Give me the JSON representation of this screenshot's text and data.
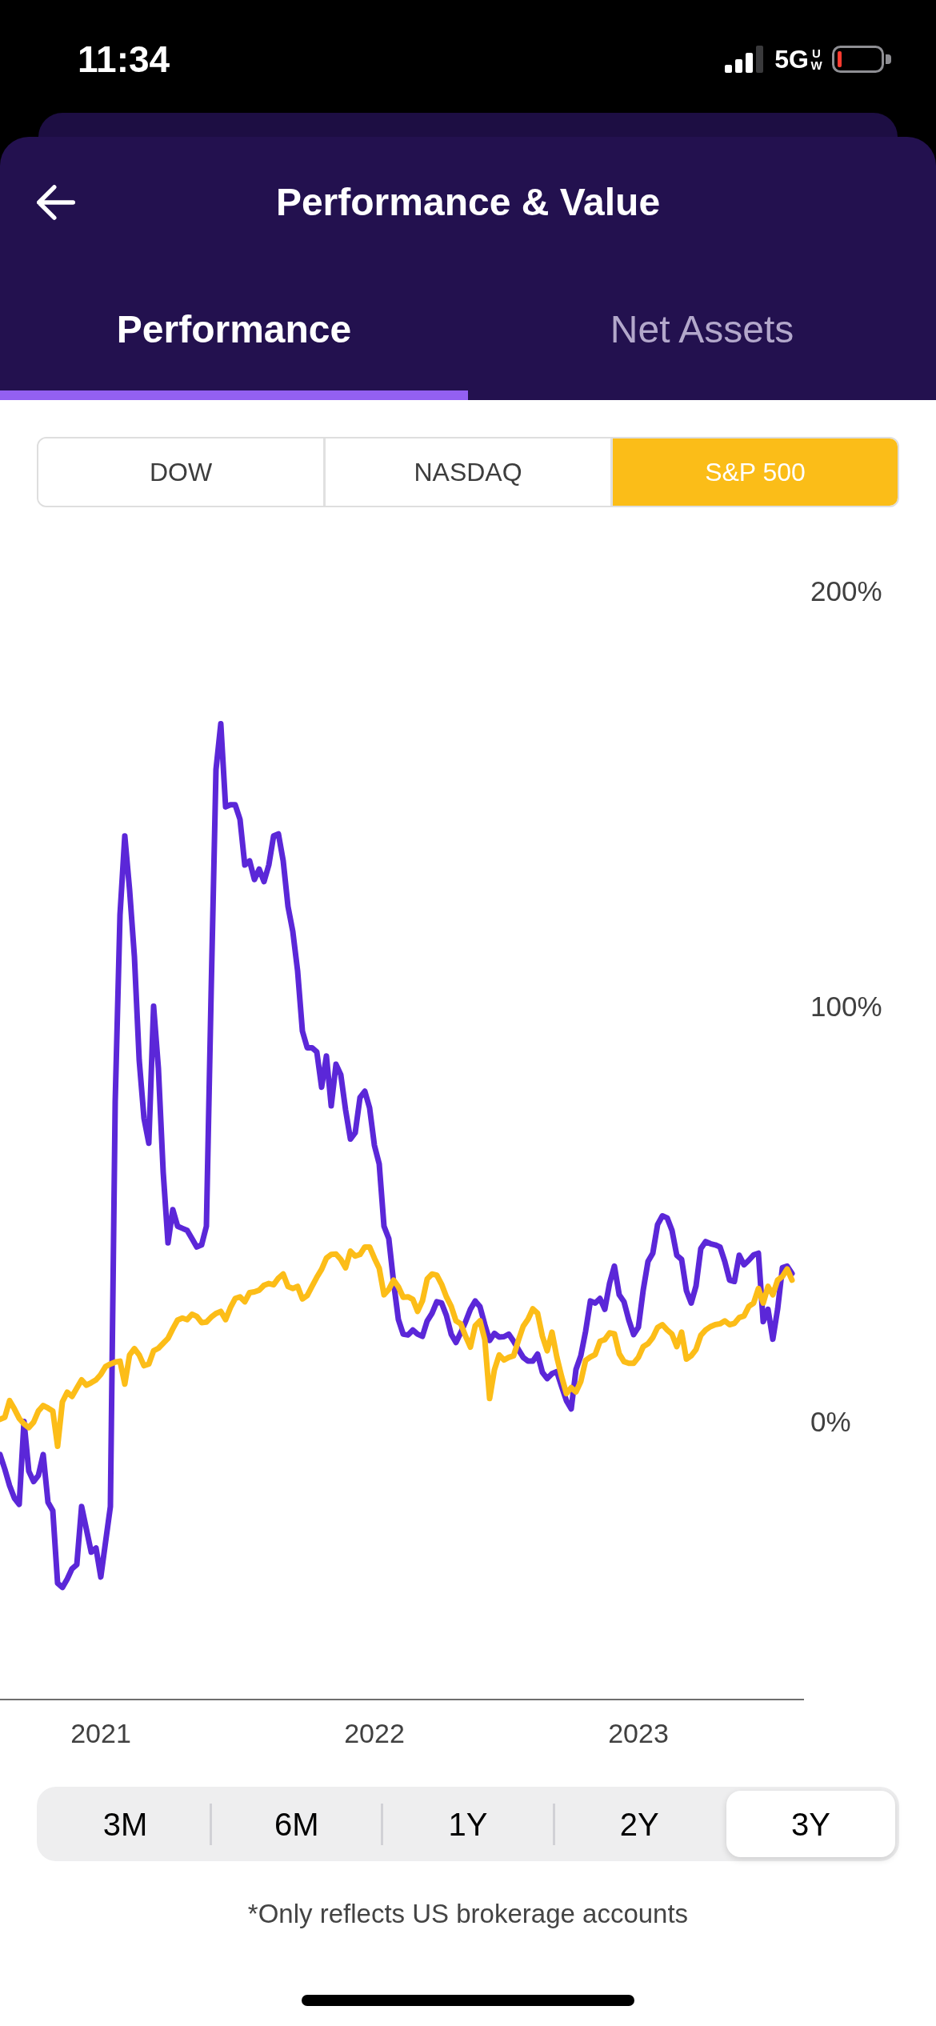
{
  "status_bar": {
    "time": "11:34",
    "network": "5G",
    "network_suffix": "UW"
  },
  "header": {
    "title": "Performance & Value"
  },
  "tabs": [
    {
      "label": "Performance",
      "selected": true
    },
    {
      "label": "Net Assets",
      "selected": false
    }
  ],
  "index_options": [
    {
      "label": "DOW",
      "selected": false
    },
    {
      "label": "NASDAQ",
      "selected": false
    },
    {
      "label": "S&P 500",
      "selected": true
    }
  ],
  "chart": {
    "chart_data": {
      "type": "line",
      "categories": [
        null,
        null,
        null,
        null,
        null,
        null,
        null,
        null,
        null,
        null,
        null,
        null,
        null,
        null,
        null,
        null,
        null,
        null,
        null,
        null,
        null,
        "2021",
        null,
        null,
        null,
        null,
        null,
        null,
        null,
        null,
        null,
        null,
        null,
        null,
        null,
        null,
        null,
        null,
        null,
        null,
        null,
        null,
        null,
        null,
        null,
        null,
        null,
        null,
        null,
        null,
        null,
        null,
        null,
        null,
        null,
        null,
        null,
        null,
        null,
        null,
        null,
        null,
        null,
        null,
        null,
        null,
        null,
        null,
        null,
        null,
        null,
        null,
        null,
        null,
        null,
        null,
        null,
        null,
        "2022",
        null,
        null,
        null,
        null,
        null,
        null,
        null,
        null,
        null,
        null,
        null,
        null,
        null,
        null,
        null,
        null,
        null,
        null,
        null,
        null,
        null,
        null,
        null,
        null,
        null,
        null,
        null,
        null,
        null,
        null,
        null,
        null,
        null,
        null,
        null,
        null,
        null,
        null,
        null,
        null,
        null,
        null,
        null,
        null,
        null,
        null,
        null,
        null,
        null,
        null,
        null,
        null,
        null,
        null,
        "2023",
        null,
        null,
        null,
        null,
        null,
        null,
        null,
        null,
        null,
        null,
        null,
        null,
        null,
        null,
        null,
        null,
        null,
        null,
        null,
        null,
        null,
        null,
        null,
        null,
        null,
        null,
        null,
        null,
        null,
        null,
        null,
        null
      ],
      "ylim": [
        -67,
        200
      ],
      "yticks": [
        {
          "value": 0,
          "label": "0%"
        },
        {
          "value": 100,
          "label": "100%"
        },
        {
          "value": 200,
          "label": "200%"
        }
      ],
      "series": [
        {
          "color": "#5b27d8",
          "values": [
            -8,
            -11.5,
            -15.5,
            -18.5,
            -20,
            0,
            -12,
            -14.5,
            -13,
            -8,
            -19.5,
            -21.5,
            -39,
            -40,
            -38,
            -35.5,
            -34.5,
            -20.5,
            -26,
            -31.5,
            -30.5,
            -37.5,
            -29,
            -20.5,
            77,
            122,
            141,
            128,
            112,
            87,
            73,
            67,
            100,
            85,
            60,
            43,
            51,
            47,
            46.5,
            46,
            44,
            42,
            42.5,
            47,
            104,
            157,
            168,
            148,
            148.5,
            148.5,
            145,
            134,
            135,
            130.5,
            133,
            130,
            134,
            141,
            141.5,
            135,
            124,
            118,
            108.5,
            94,
            90,
            90,
            89,
            80.5,
            88,
            76,
            86,
            83.5,
            75,
            68,
            69.5,
            78,
            79.5,
            75.5,
            66.5,
            62,
            47,
            44,
            33.5,
            24.5,
            21,
            20.8,
            22,
            21,
            20.5,
            24.2,
            26,
            28.8,
            28.5,
            25.5,
            21,
            19,
            21.4,
            24,
            27,
            29,
            27.6,
            23.3,
            19.5,
            21.2,
            20.3,
            20.4,
            21,
            19.3,
            17.3,
            15.4,
            14.5,
            14.5,
            16.2,
            11.8,
            10.3,
            11.5,
            12,
            8.4,
            5,
            3,
            12.5,
            15.8,
            21.7,
            29,
            28.5,
            29.6,
            27,
            33.3,
            37.4,
            30.5,
            28.8,
            24.4,
            20.9,
            22.7,
            31.6,
            38.5,
            40.5,
            47.4,
            49.5,
            49,
            46,
            40,
            39,
            31.5,
            28.5,
            32.6,
            41.6,
            43.3,
            42.8,
            42.5,
            42,
            38.5,
            34,
            33.7,
            40,
            37.7,
            38.8,
            40.1,
            40.5,
            24,
            27,
            19.8,
            27,
            37,
            37.4,
            35.6
          ]
        },
        {
          "color": "#fcbd18",
          "values": [
            0.5,
            1,
            5,
            3,
            0.7,
            -0.6,
            -1.5,
            -0.2,
            2.5,
            3.8,
            3.2,
            2.5,
            -6,
            4.7,
            7,
            6,
            8,
            10,
            8.7,
            9.3,
            10,
            11.3,
            13.2,
            13.8,
            14.3,
            14.5,
            9,
            16,
            17.5,
            16,
            13.4,
            13.8,
            17,
            17.6,
            18.8,
            20,
            22.3,
            24.4,
            24.9,
            24.5,
            25.8,
            25.3,
            23.8,
            23.9,
            25.1,
            26,
            26.5,
            24.5,
            27.4,
            29.6,
            30,
            28.8,
            31,
            31.2,
            31.6,
            32.8,
            33.2,
            32.9,
            34.5,
            35.5,
            32.5,
            32,
            32.5,
            29.5,
            30.3,
            32.5,
            34.7,
            36.6,
            39.3,
            40.2,
            40.3,
            39,
            37,
            41,
            39.8,
            40.2,
            42,
            42,
            39.3,
            36.9,
            30.5,
            31.8,
            34,
            32.4,
            29.9,
            30,
            29.4,
            26.5,
            29,
            34.3,
            35.5,
            35.2,
            33,
            30,
            27.7,
            24.2,
            23.5,
            20.5,
            17.9,
            23,
            24.2,
            19.7,
            5.5,
            12.4,
            16,
            14.8,
            15.4,
            15.8,
            19.5,
            22.9,
            24.6,
            27.1,
            26,
            20.5,
            17,
            21.5,
            15.5,
            10.8,
            6.7,
            8.1,
            7.1,
            9.6,
            14.7,
            15.5,
            16.1,
            19.3,
            19.7,
            21.3,
            21.1,
            16.3,
            14.4,
            14,
            14,
            15.4,
            18,
            18.7,
            20.2,
            22.6,
            23.3,
            22,
            21,
            18,
            21.5,
            15,
            15.8,
            17.3,
            20.7,
            22,
            22.8,
            23.3,
            23.5,
            24.2,
            23.3,
            23.6,
            25,
            25.4,
            27.7,
            28.5,
            32,
            28.5,
            32.5,
            30.5,
            34,
            34.9,
            36.7,
            34
          ]
        }
      ]
    }
  },
  "periods": [
    {
      "label": "3M",
      "selected": false
    },
    {
      "label": "6M",
      "selected": false
    },
    {
      "label": "1Y",
      "selected": false
    },
    {
      "label": "2Y",
      "selected": false
    },
    {
      "label": "3Y",
      "selected": true
    }
  ],
  "footnote": "*Only reflects US brokerage accounts"
}
